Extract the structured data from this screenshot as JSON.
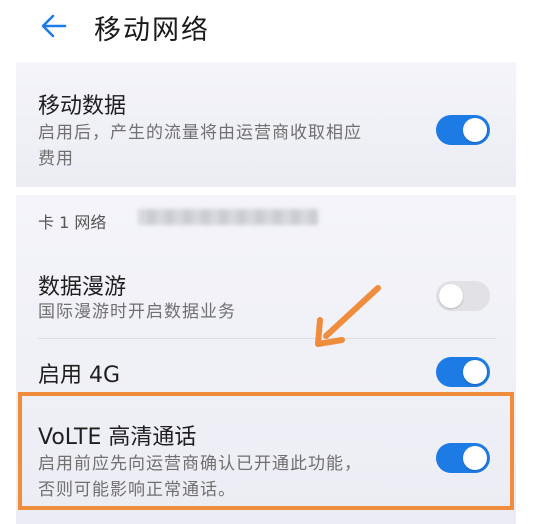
{
  "header": {
    "title": "移动网络"
  },
  "mobile_data": {
    "label": "移动数据",
    "desc_line1": "启用后，产生的流量将由运营商收取相应",
    "desc_line2": "费用",
    "enabled": true
  },
  "sim": {
    "label": "卡 1 网络"
  },
  "roaming": {
    "label": "数据漫游",
    "desc": "国际漫游时开启数据业务",
    "enabled": false
  },
  "enable_4g": {
    "label": "启用 4G",
    "enabled": true
  },
  "volte": {
    "label": "VoLTE 高清通话",
    "desc_line1": "启用前应先向运营商确认已开通此功能，",
    "desc_line2": "否则可能影响正常通话。",
    "enabled": true
  },
  "colors": {
    "accent": "#1d7be6",
    "highlight": "#ef8d3c"
  },
  "icons": [
    "back-arrow-icon",
    "annotation-arrow-icon"
  ]
}
